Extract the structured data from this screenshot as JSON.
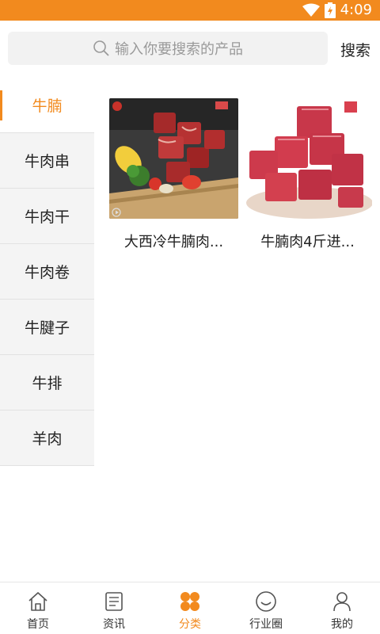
{
  "status_bar": {
    "time": "4:09",
    "battery_text": "Z"
  },
  "search": {
    "placeholder": "输入你要搜索的产品",
    "button_label": "搜索"
  },
  "sidebar": {
    "items": [
      {
        "label": "牛腩",
        "active": true
      },
      {
        "label": "牛肉串"
      },
      {
        "label": "牛肉干"
      },
      {
        "label": "牛肉卷"
      },
      {
        "label": "牛腱子"
      },
      {
        "label": "牛排"
      },
      {
        "label": "羊肉"
      }
    ]
  },
  "products": [
    {
      "name": "大西冷牛腩肉...",
      "image": "beef-cubes-on-board"
    },
    {
      "name": "牛腩肉4斤进...",
      "image": "beef-cubes-on-plate"
    }
  ],
  "bottom_nav": {
    "items": [
      {
        "label": "首页",
        "icon": "home-icon"
      },
      {
        "label": "资讯",
        "icon": "news-icon"
      },
      {
        "label": "分类",
        "icon": "category-icon",
        "active": true
      },
      {
        "label": "行业圈",
        "icon": "industry-circle-icon"
      },
      {
        "label": "我的",
        "icon": "profile-icon"
      }
    ]
  },
  "colors": {
    "accent": "#f28a1e",
    "sidebar_bg": "#f4f4f4",
    "search_bg": "#f2f2f2"
  }
}
